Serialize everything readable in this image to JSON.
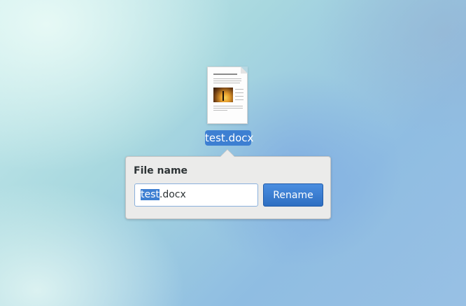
{
  "file": {
    "name": "test.docx",
    "icon": "docx-thumbnail-icon"
  },
  "popover": {
    "title": "File name",
    "input": {
      "value": "test.docx",
      "selected_part": "test",
      "unselected_part": ".docx"
    },
    "rename_label": "Rename"
  },
  "colors": {
    "selection": "#3d7fd2",
    "accent_button": "#3a7fd6"
  }
}
